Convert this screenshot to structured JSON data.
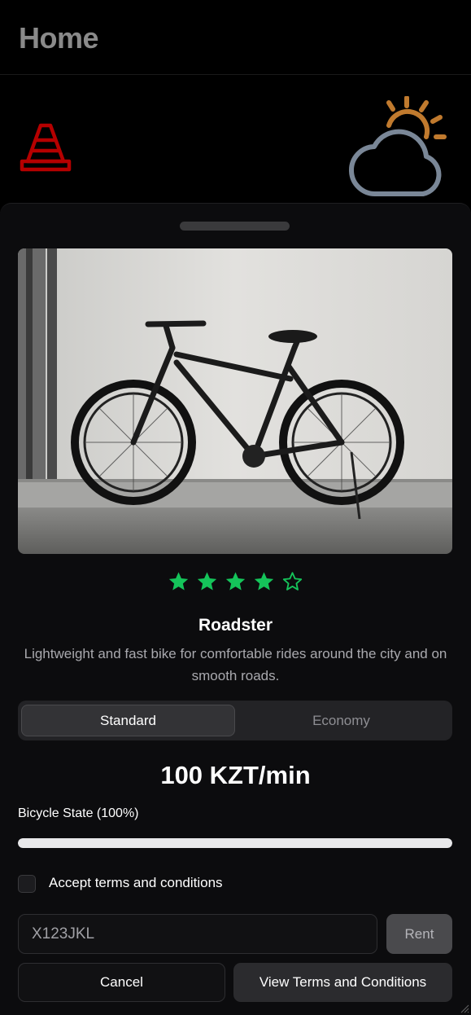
{
  "header": {
    "title": "Home"
  },
  "icons": {
    "cone": "traffic-cone-icon",
    "weather": "partly-cloudy-icon",
    "cone_color": "#b50000",
    "cloud_color": "#7a8797",
    "sun_color": "#c07a2e"
  },
  "sheet": {
    "photo": {
      "subject": "bicycle-photo"
    },
    "rating": {
      "value": 4,
      "max": 5,
      "color": "#15c45a"
    },
    "bike": {
      "name": "Roadster",
      "description": "Lightweight and fast bike for comfortable rides around the city and on smooth roads."
    },
    "tariff": {
      "options": [
        "Standard",
        "Economy"
      ],
      "selected": "Standard"
    },
    "price": "100 KZT/min",
    "state": {
      "label": "Bicycle State (100%)",
      "percent": 100
    },
    "terms": {
      "label": "Accept terms and conditions",
      "checked": false
    },
    "code_input": {
      "value": "X123JKL"
    },
    "buttons": {
      "rent": "Rent",
      "cancel": "Cancel",
      "view_terms": "View Terms and Conditions"
    }
  }
}
